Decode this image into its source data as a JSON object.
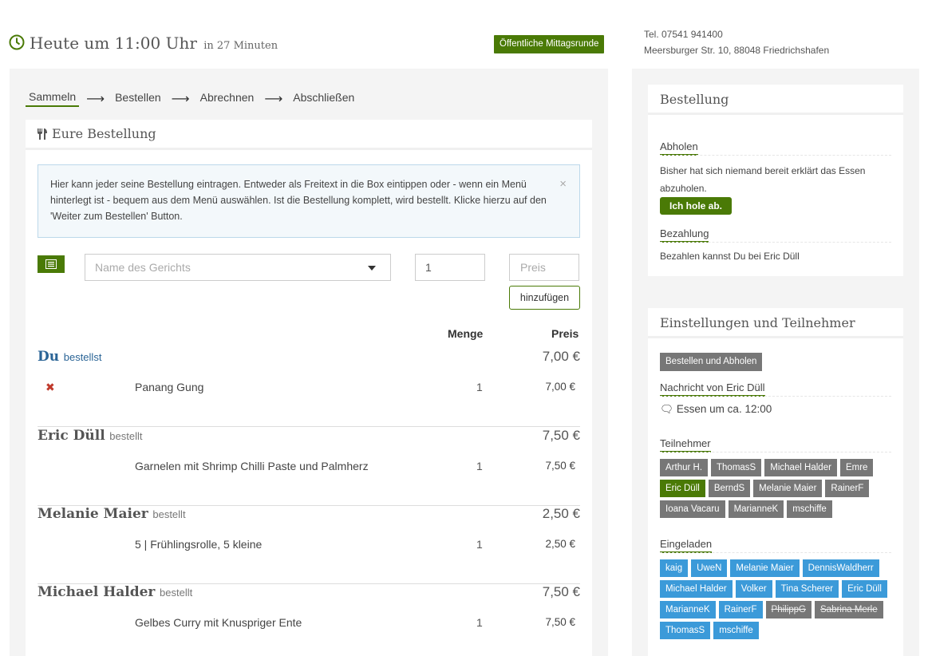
{
  "header": {
    "time_label": "Heute um 11:00 Uhr",
    "relative_label": "in 27 Minuten",
    "public_badge": "Öffentliche Mittagsrunde",
    "phone": "Tel. 07541 941400",
    "address": "Meersburger Str. 10, 88048 Friedrichshafen"
  },
  "steps": [
    "Sammeln",
    "Bestellen",
    "Abrechnen",
    "Abschließen"
  ],
  "order_card": {
    "title": "Eure Bestellung",
    "info_text": "Hier kann jeder seine Bestellung eintragen. Entweder als Freitext in die Box eintippen oder - wenn ein Menü hinterlegt ist - bequem aus dem Menü auswählen. Ist die Bestellung komplett, wird bestellt. Klicke hierzu auf den 'Weiter zum Bestellen' Button.",
    "info_close": "×",
    "dish_placeholder": "Name des Gerichts",
    "qty_value": "1",
    "price_placeholder": "Preis",
    "add_label": "hinzufügen",
    "col_qty": "Menge",
    "col_price": "Preis"
  },
  "orders": [
    {
      "name": "Du",
      "verb": "bestellst",
      "total": "7,00 €",
      "dish": "Panang Gung",
      "qty": "1",
      "price": "7,00 €",
      "delete": "✖"
    },
    {
      "name": "Eric Düll",
      "verb": "bestellt",
      "total": "7,50 €",
      "dish": "Garnelen mit Shrimp Chilli Paste und Palmherz",
      "qty": "1",
      "price": "7,50 €"
    },
    {
      "name": "Melanie Maier",
      "verb": "bestellt",
      "total": "2,50 €",
      "dish": "5 | Frühlingsrolle, 5 kleine",
      "qty": "1",
      "price": "2,50 €"
    },
    {
      "name": "Michael Halder",
      "verb": "bestellt",
      "total": "7,50 €",
      "dish": "Gelbes Curry mit Knuspriger Ente",
      "qty": "1",
      "price": "7,50 €"
    }
  ],
  "bestellung": {
    "title": "Bestellung",
    "pickup_heading": "Abholen",
    "pickup_text": "Bisher hat sich niemand bereit erklärt das Essen abzuholen.",
    "pickup_button": "Ich hole ab.",
    "payment_heading": "Bezahlung",
    "payment_text": "Bezahlen kannst Du bei Eric Düll"
  },
  "settings": {
    "title": "Einstellungen und Teilnehmer",
    "mode_button": "Bestellen und Abholen",
    "message_heading": "Nachricht von Eric Düll",
    "message_text": "Essen um ca. 12:00",
    "participants_heading": "Teilnehmer",
    "participants": [
      "Arthur H.",
      "ThomasS",
      "Michael Halder",
      "Emre",
      "Eric Düll",
      "BerndS",
      "Melanie Maier",
      "RainerF",
      "Ioana Vacaru",
      "MarianneK",
      "mschiffe"
    ],
    "invited_heading": "Eingeladen",
    "invited": [
      "kaig",
      "UweN",
      "Melanie Maier",
      "DennisWaldherr",
      "Michael Halder",
      "Volker",
      "Tina Scherer",
      "Eric Düll",
      "MarianneK",
      "RainerF",
      "PhilippG",
      "Sabrina Merle",
      "ThomasS",
      "mschiffe"
    ]
  },
  "colors": {
    "accent": "#4a7a06",
    "invited": "#3b9ad9",
    "participant": "#777777"
  }
}
